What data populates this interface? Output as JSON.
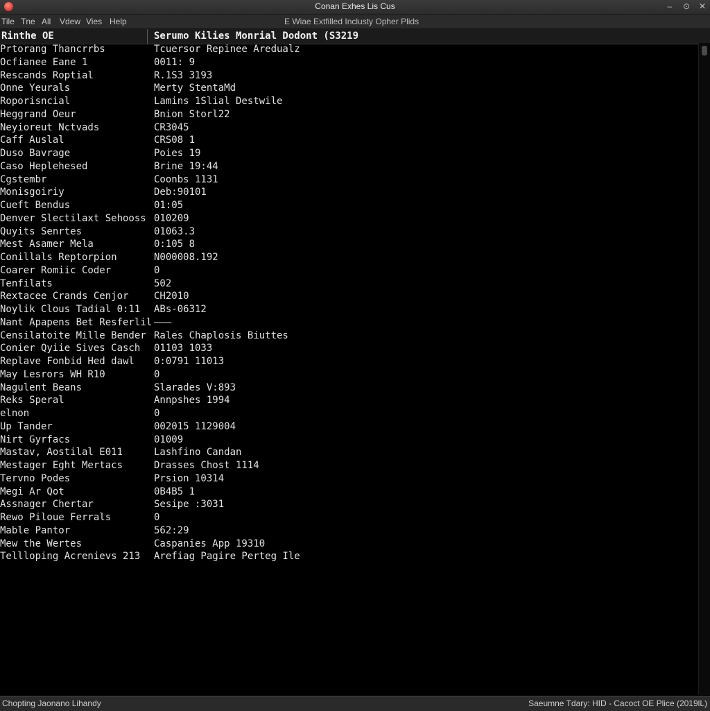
{
  "window": {
    "title": "Conan Exhes Lis Cus",
    "controls": [
      "–",
      "⊙",
      "✕"
    ]
  },
  "menubar": {
    "items": [
      "Tile",
      "Tne",
      "All",
      "Vdew",
      "Vies",
      "Help"
    ],
    "right_text": "E Wiae Extfilled Inclusty Opher Plids"
  },
  "columns": {
    "left_header": "Rinthe OE",
    "right_header": "Serumo Kilies Monrial Dodont (S3219"
  },
  "rows": [
    {
      "name": "Prtorang Thancrrbs",
      "value": "Tcuersor Repinee Aredualz"
    },
    {
      "name": "Ocfianee Eane 1",
      "value": "0011: 9"
    },
    {
      "name": "Rescands Roptial",
      "value": "R.1S3 3193"
    },
    {
      "name": "Onne Yeurals",
      "value": "Merty StentaMd"
    },
    {
      "name": "Roporisncial",
      "value": "Lamins 1Slial Destwile"
    },
    {
      "name": "Heggrand Oeur",
      "value": "Bnion Storl22"
    },
    {
      "name": "Neyioreut Nctvads",
      "value": "CR3045"
    },
    {
      "name": "Caff Auslal",
      "value": "CRS08 1"
    },
    {
      "name": "Duso Bavrage",
      "value": "Poies 19"
    },
    {
      "name": "Caso Heplehesed",
      "value": "Brine 19:44"
    },
    {
      "name": "Cgstembr",
      "value": "Coonbs 1131"
    },
    {
      "name": "Monisgoiriy",
      "value": "Deb:90101"
    },
    {
      "name": "Cueft Bendus",
      "value": "01:05"
    },
    {
      "name": "Denver Slectilaxt Sehooss",
      "value": "010209"
    },
    {
      "name": "Quyits Senrtes",
      "value": "01063.3"
    },
    {
      "name": "Mest Asamer Mela",
      "value": "0:105 8"
    },
    {
      "name": "Conillals Reptorpion",
      "value": "N000008.192"
    },
    {
      "name": "Coarer Romiic Coder",
      "value": "0"
    },
    {
      "name": "Tenfilats",
      "value": "502"
    },
    {
      "name": "Rextacee Crands Cenjor",
      "value": "CH2010"
    },
    {
      "name": "Noylik Clous Tadial 0:11",
      "value": "ABs-06312"
    },
    {
      "name": "Nant Apapens Bet Resferlil",
      "value": "———"
    },
    {
      "name": "Censilatoite Mille Bender",
      "value": "Rales Chaplosis Biuttes"
    },
    {
      "name": "Conier Qyiie Sives Casch",
      "value": "01103 1033"
    },
    {
      "name": "Replave Fonbid Hed dawl",
      "value": "0:0791 11013"
    },
    {
      "name": "May Lesrors WH R10",
      "value": "0"
    },
    {
      "name": "Nagulent Beans",
      "value": "Slarades V:893"
    },
    {
      "name": "Reks Speral",
      "value": "Annpshes 1994"
    },
    {
      "name": "elnon",
      "value": "0"
    },
    {
      "name": "Up Tander",
      "value": "002015 1129004"
    },
    {
      "name": "Nirt Gyrfacs",
      "value": "01009"
    },
    {
      "name": "Mastav, Aostilal E011",
      "value": "Lashfino Candan"
    },
    {
      "name": "Mestager Eght Mertacs",
      "value": "Drasses Chost 1114"
    },
    {
      "name": "Tervno Podes",
      "value": "Prsion 10314"
    },
    {
      "name": "Megi Ar Qot",
      "value": "0B4B5 1"
    },
    {
      "name": "Assnager Chertar",
      "value": "Sesipe :3031"
    },
    {
      "name": "Rewo Piloue Ferrals",
      "value": "0"
    },
    {
      "name": "Mable Pantor",
      "value": "562:29"
    },
    {
      "name": "Mew the Wertes",
      "value": "Caspanies App 19310"
    },
    {
      "name": "Tellloping Acrenievs 213",
      "value": "Arefiag Pagire Perteg Ile"
    }
  ],
  "statusbar": {
    "left": "Chopting Jaonano Lihandy",
    "right": "Saeumne Tdary: HID  -  Cacoct OE Plice (2019lL)"
  }
}
